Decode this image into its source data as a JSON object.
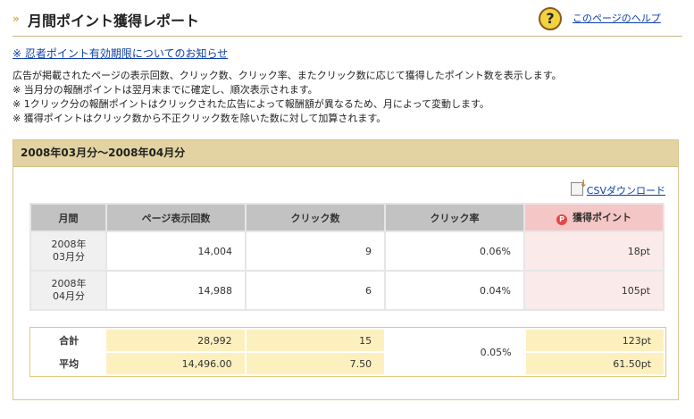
{
  "header": {
    "title_mark": "»",
    "title": "月間ポイント獲得レポート",
    "help_icon": "?",
    "help_link": "このページのヘルプ"
  },
  "notice_link": "※ 忍者ポイント有効期限についてのお知らせ",
  "description": [
    "広告が掲載されたページの表示回数、クリック数、クリック率、またクリック数に応じて獲得したポイント数を表示します。",
    "※ 当月分の報酬ポイントは翌月末までに確定し、順次表示されます。",
    "※ 1クリック分の報酬ポイントはクリックされた広告によって報酬額が異なるため、月によって変動します。",
    "※ 獲得ポイントはクリック数から不正クリック数を除いた数に対して加算されます。"
  ],
  "report": {
    "period": "2008年03月分〜2008年04月分",
    "csv_link": "CSVダウンロード",
    "columns": [
      "月間",
      "ページ表示回数",
      "クリック数",
      "クリック率",
      "獲得ポイント"
    ],
    "points_icon": "P",
    "rows": [
      {
        "year": "2008年",
        "month": "03月分",
        "views": "14,004",
        "clicks": "9",
        "rate": "0.06%",
        "points": "18pt"
      },
      {
        "year": "2008年",
        "month": "04月分",
        "views": "14,988",
        "clicks": "6",
        "rate": "0.04%",
        "points": "105pt"
      }
    ],
    "total": {
      "label": "合計",
      "views": "28,992",
      "clicks": "15",
      "points": "123pt"
    },
    "average": {
      "label": "平均",
      "views": "14,496.00",
      "clicks": "7.50",
      "points": "61.50pt"
    },
    "overall_rate": "0.05%"
  }
}
